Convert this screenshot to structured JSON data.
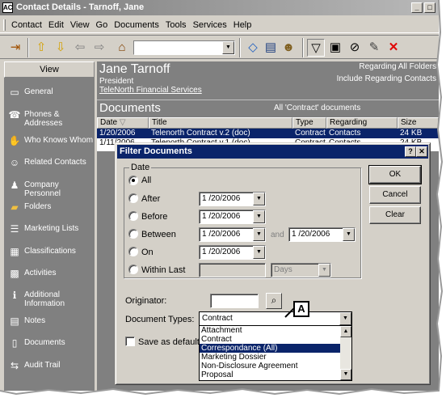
{
  "window": {
    "title": "Contact Details - Tarnoff, Jane"
  },
  "menu": [
    "Contact",
    "Edit",
    "View",
    "Go",
    "Documents",
    "Tools",
    "Services",
    "Help"
  ],
  "sidebar": {
    "header": "View",
    "items": [
      {
        "label": "General",
        "icon": "address-card-icon"
      },
      {
        "label": "Phones & Addresses",
        "icon": "phone-icon"
      },
      {
        "label": "Who Knows Whom",
        "icon": "handshake-icon"
      },
      {
        "label": "Related Contacts",
        "icon": "people-icon"
      },
      {
        "label": "Company Personnel",
        "icon": "company-icon"
      },
      {
        "label": "Folders",
        "icon": "folder-icon"
      },
      {
        "label": "Marketing Lists",
        "icon": "list-icon"
      },
      {
        "label": "Classifications",
        "icon": "classification-icon"
      },
      {
        "label": "Activities",
        "icon": "calendar-icon"
      },
      {
        "label": "Additional Information",
        "icon": "info-icon"
      },
      {
        "label": "Notes",
        "icon": "note-icon"
      },
      {
        "label": "Documents",
        "icon": "document-icon"
      },
      {
        "label": "Audit Trail",
        "icon": "audit-icon"
      }
    ]
  },
  "contact": {
    "name": "Jane Tarnoff",
    "title": "President",
    "company": "TeleNorth Financial Services",
    "regarding_folders": "Regarding All Folders",
    "regarding_contacts": "Include Regarding Contacts"
  },
  "documents": {
    "header": "Documents",
    "filter_summary": "All 'Contract' documents",
    "columns": [
      "Date",
      "Title",
      "Type",
      "Regarding",
      "Size"
    ],
    "rows": [
      {
        "date": "1/20/2006",
        "title": "Telenorth Contract v.2 (doc)",
        "type": "Contract",
        "regarding": "Contacts",
        "size": "24 KB",
        "selected": true
      },
      {
        "date": "1/11/2006",
        "title": "Telenorth Contract v.1 (doc)",
        "type": "Contract",
        "regarding": "Contacts",
        "size": "24 KB",
        "selected": false
      }
    ]
  },
  "dialog": {
    "title": "Filter Documents",
    "group_label": "Date",
    "options": {
      "all": "All",
      "after": "After",
      "before": "Before",
      "between": "Between",
      "on": "On",
      "within_last": "Within Last"
    },
    "selected_option": "all",
    "dates": {
      "after": "1 /20/2006",
      "before": "1 /20/2006",
      "between_from": "1 /20/2006",
      "between_to": "1 /20/2006",
      "on": "1 /20/2006"
    },
    "and_label": "and",
    "within_unit": "Days",
    "originator_label": "Originator:",
    "originator_value": "",
    "doctype_label": "Document Types:",
    "doctype_value": "Contract",
    "doctype_options": [
      "Attachment",
      "Contract",
      "Correspondance (All)",
      "Marketing Dossier",
      "Non-Disclosure Agreement",
      "Proposal"
    ],
    "doctype_highlighted": "Correspondance (All)",
    "save_default_label": "Save as default Do",
    "buttons": {
      "ok": "OK",
      "cancel": "Cancel",
      "clear": "Clear"
    },
    "help_btn": "?",
    "close_btn": "✕"
  },
  "callout": "A",
  "colors": {
    "selection": "#0a246a",
    "panel": "#808080",
    "chrome": "#d4d0c8"
  }
}
